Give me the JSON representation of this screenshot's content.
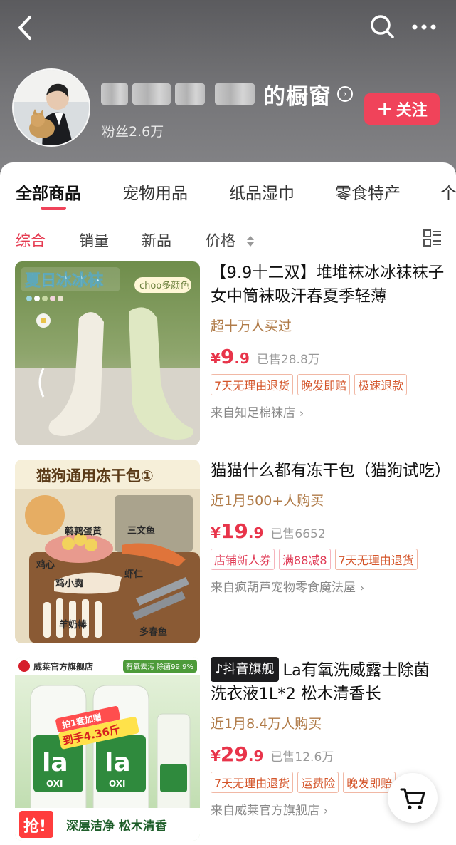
{
  "header": {
    "store_name": "的橱窗",
    "fans": "粉丝2.6万",
    "follow_label": "关注",
    "follow_plus": "+"
  },
  "category_tabs": [
    "全部商品",
    "宠物用品",
    "纸品湿巾",
    "零食特产",
    "个"
  ],
  "sort_options": [
    "综合",
    "销量",
    "新品",
    "价格"
  ],
  "products": [
    {
      "title": "【9.9十二双】堆堆袜冰冰袜袜子女中筒袜吸汗春夏季轻薄",
      "sales_hint": "超十万人买过",
      "price_currency": "¥",
      "price_int": "9",
      "price_dec": ".9",
      "sold": "已售28.8万",
      "tags": [
        "7天无理由退货",
        "晚发即赔",
        "极速退款"
      ],
      "shop": "来自知足棉袜店",
      "image_text": {
        "banner": "夏日冰冰袜",
        "colors": "choo多颜色"
      }
    },
    {
      "title": "猫猫什么都有冻干包（猫狗试吃）",
      "sales_hint": "近1月500+人购买",
      "price_currency": "¥",
      "price_int": "19",
      "price_dec": ".9",
      "sold": "已售6652",
      "tags": [
        "店铺新人券",
        "满88减8",
        "7天无理由退货"
      ],
      "shop": "来自疯葫芦宠物零食魔法屋",
      "image_text": {
        "banner": "猫狗通用冻干包①",
        "labels": [
          "鹌鹑蛋黄",
          "三文鱼",
          "鸡心",
          "虾仁",
          "鸡小胸",
          "羊奶棒",
          "多春鱼"
        ]
      }
    },
    {
      "badge": "抖音旗舰",
      "title": "La有氧洗威露士除菌洗衣液1L*2 松木清香长",
      "sales_hint": "近1月8.4万人购买",
      "price_currency": "¥",
      "price_int": "29",
      "price_dec": ".9",
      "sold": "已售12.6万",
      "tags": [
        "7天无理由退货",
        "运费险",
        "晚发即赔"
      ],
      "shop": "来自威莱官方旗舰店",
      "image_text": {
        "store": "威莱官方旗舰店",
        "claim": "有氧去污 除菌99.9%",
        "promo1": "拍1套加赠",
        "promo2": "到手4.36斤",
        "grab": "抢!",
        "slogan": "深层洁净 松木清香",
        "brand": "la",
        "oxi": "OXI"
      }
    }
  ],
  "colors": {
    "accent": "#f0435a",
    "price": "#e8344a",
    "sales": "#b07b48"
  }
}
